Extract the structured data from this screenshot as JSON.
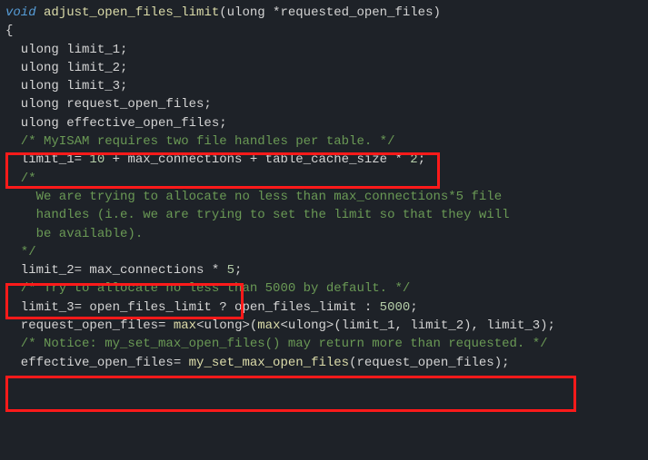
{
  "l1_void": "void",
  "l1_fn": " adjust_open_files_limit",
  "l1_rest": "(ulong *requested_open_files)",
  "l2": "{",
  "l3": "  ulong limit_1;",
  "l4": "  ulong limit_2;",
  "l5": "  ulong limit_3;",
  "l6": "  ulong request_open_files;",
  "l7": "  ulong effective_open_files;",
  "l8": "",
  "l9": "  /* MyISAM requires two file handles per table. */",
  "l10": "  limit_1= 10 + max_connections + table_cache_size * 2;",
  "l11": "",
  "l12": "  /*",
  "l13": "    We are trying to allocate no less than max_connections*5 file",
  "l14": "    handles (i.e. we are trying to set the limit so that they will",
  "l15": "    be available).",
  "l16": "  */",
  "l17": "  limit_2= max_connections * 5;",
  "l18": "",
  "l19": "  /* Try to allocate no less than 5000 by default. */",
  "l20": "  limit_3= open_files_limit ? open_files_limit : 5000;",
  "l21": "",
  "l22_a": "  request_open_files= ",
  "l22_max1": "max",
  "l22_t1": "<ulong>",
  "l22_p1": "(",
  "l22_max2": "max",
  "l22_t2": "<ulong>",
  "l22_rest": "(limit_1, limit_2), limit_3);",
  "l23": "",
  "l24": "  /* Notice: my_set_max_open_files() may return more than requested. */",
  "l25_a": "  effective_open_files= ",
  "l25_fn": "my_set_max_open_files",
  "l25_rest": "(request_open_files);"
}
